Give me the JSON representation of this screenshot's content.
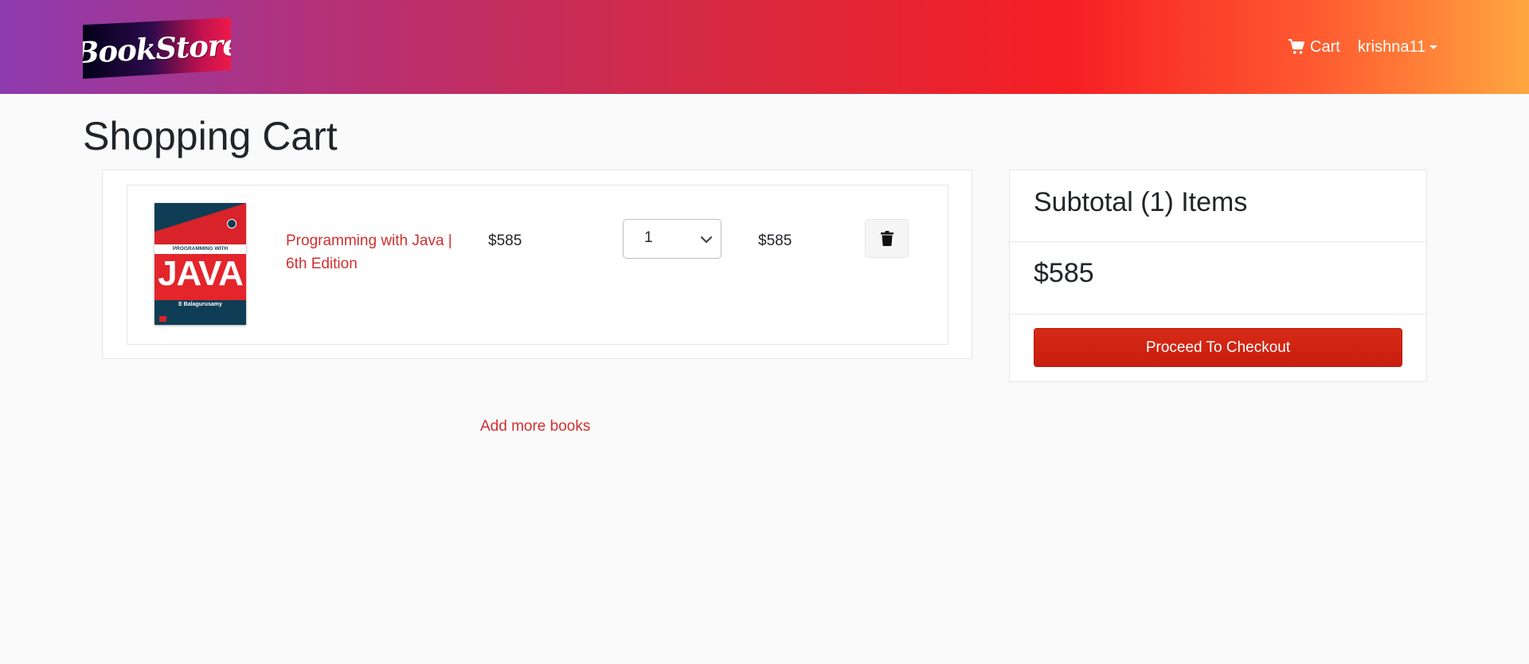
{
  "navbar": {
    "brand": "BookStore",
    "cart_label": "Cart",
    "user_label": "krishna11",
    "gradient_colors": [
      "#8e3bb0",
      "#f61f24",
      "#ffa640"
    ]
  },
  "page": {
    "title": "Shopping Cart"
  },
  "cart": {
    "items": [
      {
        "title": "Programming with Java | 6th Edition",
        "price": "$585",
        "quantity": "1",
        "total": "$585",
        "cover": {
          "top_text": "PROGRAMMING WITH",
          "main_text": "JAVA",
          "author": "E Balagurusamy"
        }
      }
    ],
    "add_more_label": "Add more books"
  },
  "summary": {
    "heading": "Subtotal (1) Items",
    "subtotal": "$585",
    "checkout_label": "Proceed To Checkout"
  },
  "colors": {
    "accent": "#d32f2f",
    "checkout_button": "#cc2211"
  },
  "icons": {
    "cart": "shopping-cart-icon",
    "delete": "trash-icon",
    "dropdown": "chevron-down-icon",
    "user_menu": "caret-down-icon"
  }
}
